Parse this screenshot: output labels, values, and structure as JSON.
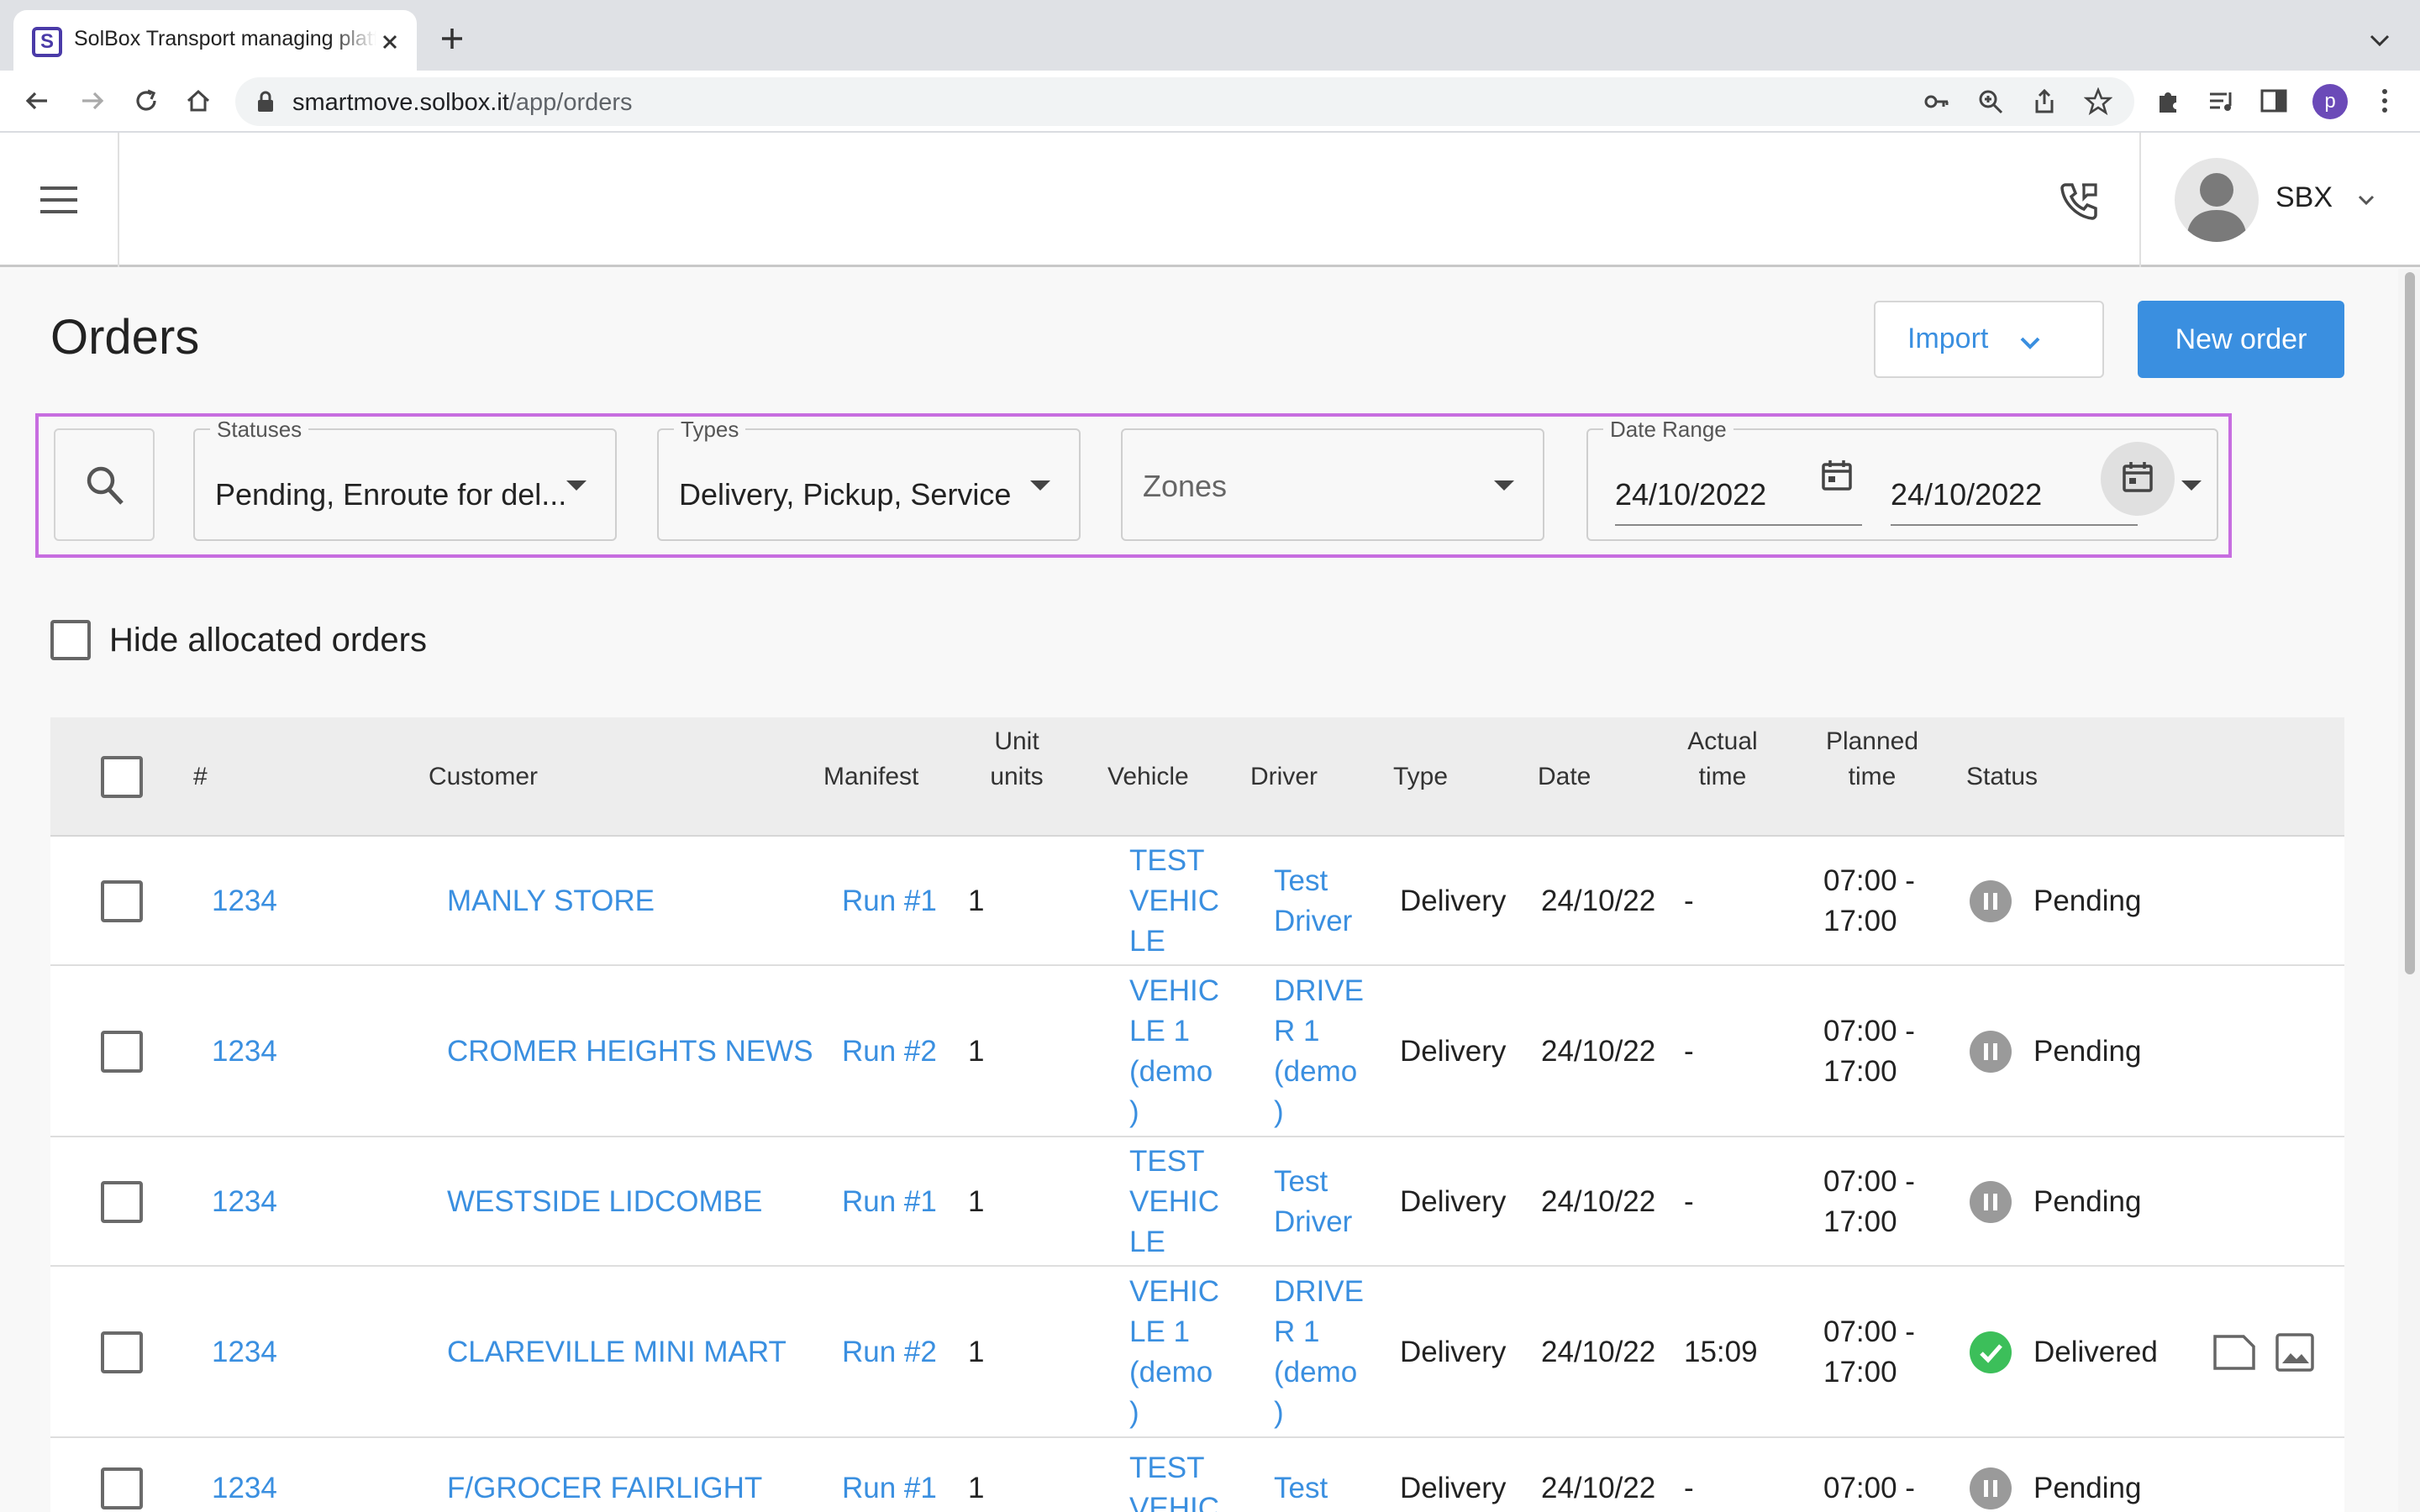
{
  "browser": {
    "tab_title": "SolBox Transport managing platform",
    "favicon_letter": "S",
    "url_domain": "smartmove.solbox.it",
    "url_path": "/app/orders",
    "profile_initial": "p"
  },
  "header": {
    "user_name": "SBX"
  },
  "page": {
    "title": "Orders",
    "import_label": "Import",
    "new_order_label": "New order"
  },
  "filters": {
    "statuses_label": "Statuses",
    "statuses_value": "Pending, Enroute for del...",
    "types_label": "Types",
    "types_value": "Delivery, Pickup, Service",
    "zones_placeholder": "Zones",
    "date_range_label": "Date Range",
    "date_from": "24/10/2022",
    "date_to": "24/10/2022",
    "hide_allocated_label": "Hide allocated orders"
  },
  "table": {
    "columns": {
      "number": "#",
      "customer": "Customer",
      "manifest": "Manifest",
      "unit_units": "Unit units",
      "vehicle": "Vehicle",
      "driver": "Driver",
      "type": "Type",
      "date": "Date",
      "actual_time": "Actual time",
      "planned_time": "Planned time",
      "status": "Status"
    },
    "rows": [
      {
        "number": "1234",
        "customer": "MANLY STORE",
        "manifest": "Run #1",
        "units": "1",
        "vehicle": "TEST VEHIC LE",
        "driver": "Test Driver",
        "type": "Delivery",
        "date": "24/10/22",
        "actual_time": "-",
        "planned_time": "07:00 - 17:00",
        "status": "Pending"
      },
      {
        "number": "1234",
        "customer": "CROMER HEIGHTS NEWS",
        "manifest": "Run #2",
        "units": "1",
        "vehicle": "VEHIC LE 1 (demo )",
        "driver": "DRIVE R 1 (demo )",
        "type": "Delivery",
        "date": "24/10/22",
        "actual_time": "-",
        "planned_time": "07:00 - 17:00",
        "status": "Pending"
      },
      {
        "number": "1234",
        "customer": "WESTSIDE LIDCOMBE",
        "manifest": "Run #1",
        "units": "1",
        "vehicle": "TEST VEHIC LE",
        "driver": "Test Driver",
        "type": "Delivery",
        "date": "24/10/22",
        "actual_time": "-",
        "planned_time": "07:00 - 17:00",
        "status": "Pending"
      },
      {
        "number": "1234",
        "customer": "CLAREVILLE MINI MART",
        "manifest": "Run #2",
        "units": "1",
        "vehicle": "VEHIC LE 1 (demo )",
        "driver": "DRIVE R 1 (demo )",
        "type": "Delivery",
        "date": "24/10/22",
        "actual_time": "15:09",
        "planned_time": "07:00 - 17:00",
        "status": "Delivered"
      },
      {
        "number": "1234",
        "customer": "F/GROCER FAIRLIGHT",
        "manifest": "Run #1",
        "units": "1",
        "vehicle": "TEST VEHIC",
        "driver": "Test",
        "type": "Delivery",
        "date": "24/10/22",
        "actual_time": "-",
        "planned_time": "07:00 -",
        "status": "Pending"
      }
    ]
  },
  "colors": {
    "accent": "#3a8fe0",
    "filter_highlight": "#c76de0",
    "pending": "#9a9a9a",
    "delivered": "#3cbf5a"
  },
  "icons": {
    "menu": "menu-icon",
    "phone": "phone-call-icon",
    "search": "search-icon",
    "calendar": "calendar-icon",
    "status_pending": "pause-icon",
    "status_delivered": "check-icon",
    "file": "file-icon",
    "image": "image-icon"
  }
}
